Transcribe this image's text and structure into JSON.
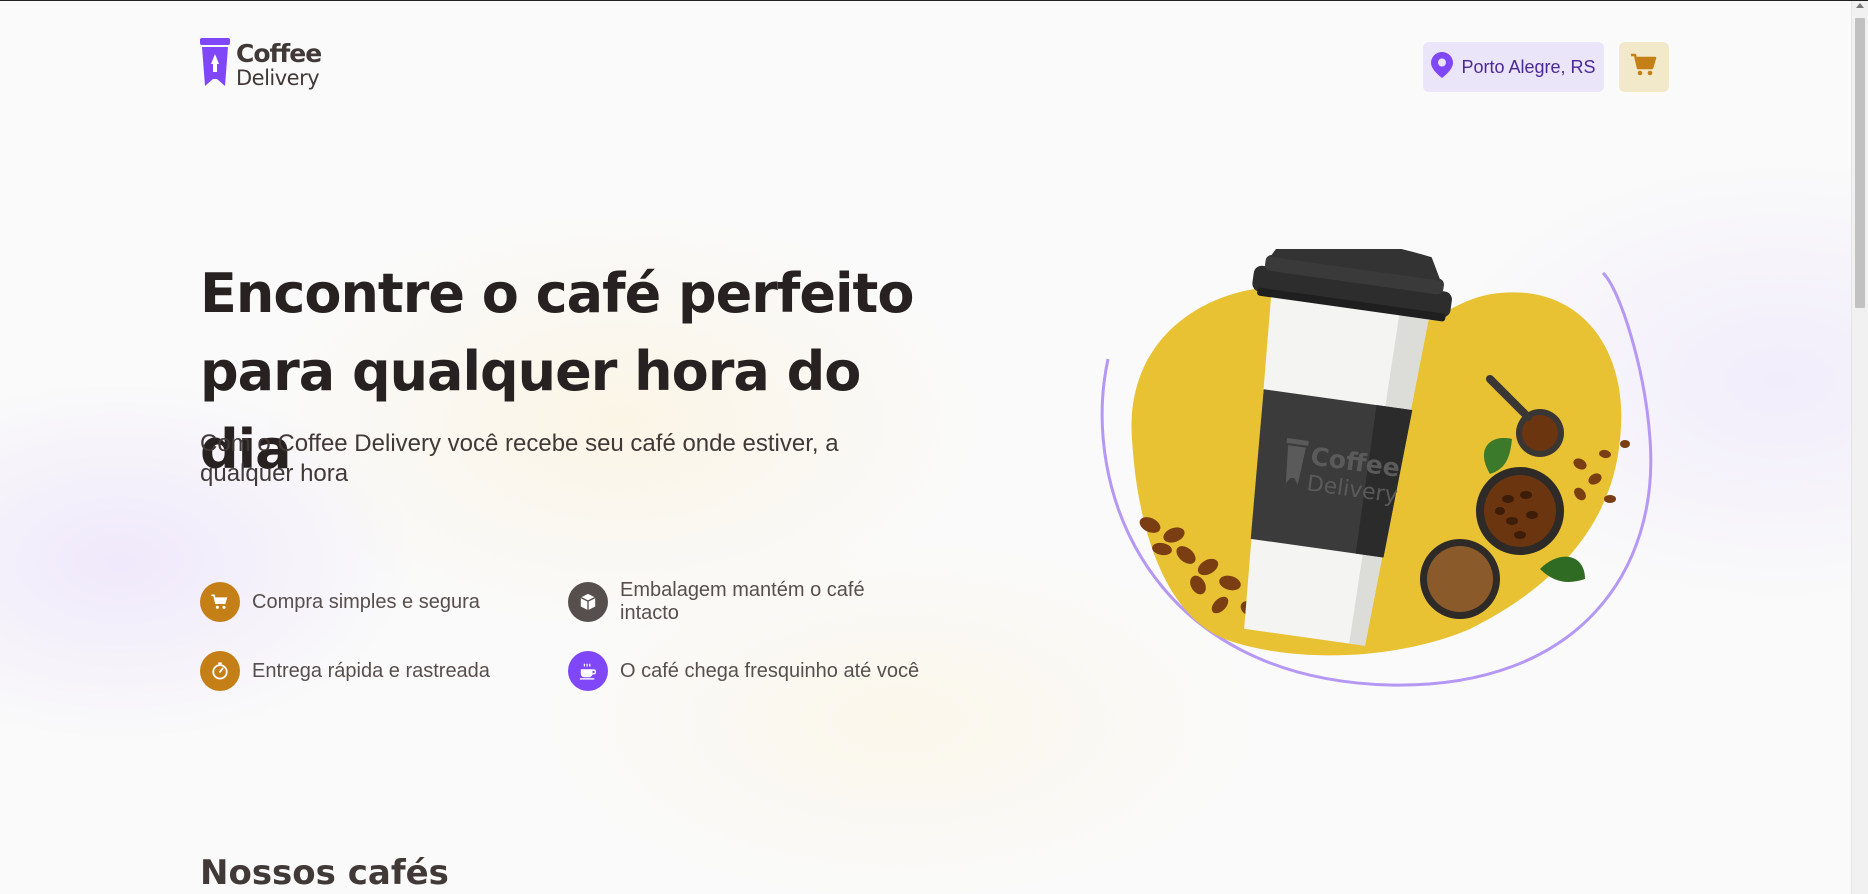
{
  "header": {
    "logo_line1": "Coffee",
    "logo_line2": "Delivery",
    "location": "Porto Alegre, RS",
    "location_icon": "map-pin-icon",
    "cart_icon": "shopping-cart-icon"
  },
  "hero": {
    "title": "Encontre o café perfeito para qualquer hora do dia",
    "subtitle": "Com o Coffee Delivery você recebe seu café onde estiver, a qualquer hora",
    "features": [
      {
        "label": "Compra simples e segura",
        "icon": "shopping-cart-icon",
        "color": "#c47f17"
      },
      {
        "label": "Embalagem mantém o café intacto",
        "icon": "package-icon",
        "color": "#574f4d"
      },
      {
        "label": "Entrega rápida e rastreada",
        "icon": "timer-icon",
        "color": "#c47f17"
      },
      {
        "label": "O café chega fresquinho até você",
        "icon": "coffee-icon",
        "color": "#8047f8"
      }
    ],
    "image_cup_logo_line1": "Coffee",
    "image_cup_logo_line2": "Delivery"
  },
  "catalog": {
    "title": "Nossos cafés"
  },
  "colors": {
    "purple": "#8047f8",
    "purple_dark": "#4b2995",
    "purple_light": "#ebe5f9",
    "yellow": "#dbac2c",
    "yellow_dark": "#c47f17",
    "yellow_light": "#f1e9c9",
    "title": "#272221"
  }
}
